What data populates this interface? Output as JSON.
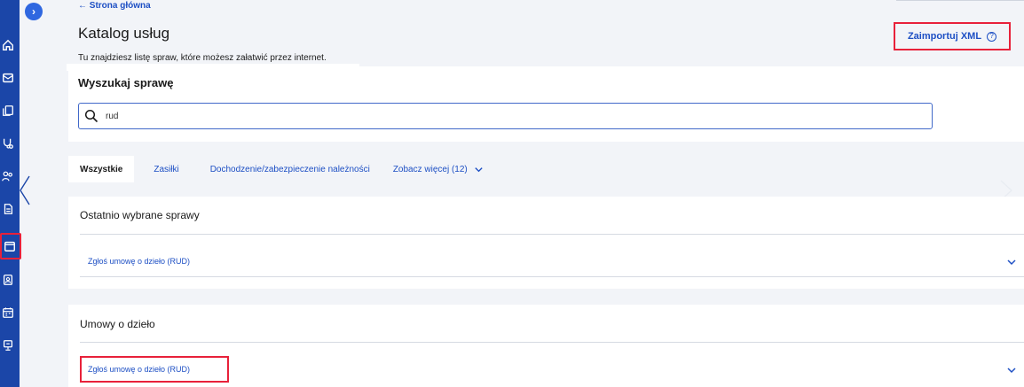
{
  "breadcrumb": {
    "back_label": "← Strona główna"
  },
  "header": {
    "title": "Katalog usług",
    "subtitle": "Tu znajdziesz listę spraw, które możesz załatwić przez internet.",
    "import_label": "Zaimportuj XML",
    "help_glyph": "?"
  },
  "search": {
    "label": "Wyszukaj sprawę",
    "value": "rud"
  },
  "tabs": [
    {
      "label": "Wszystkie"
    },
    {
      "label": "Zasiłki"
    },
    {
      "label": "Dochodzenie/zabezpieczenie należności"
    },
    {
      "label": "Zobacz więcej (12)"
    }
  ],
  "sections": [
    {
      "title": "Ostatnio wybrane sprawy",
      "items": [
        {
          "label": "Zgłoś umowę o dzieło (RUD)"
        }
      ]
    },
    {
      "title": "Umowy o dzieło",
      "items": [
        {
          "label": "Zgłoś umowę o dzieło (RUD)"
        }
      ]
    }
  ],
  "rail": {
    "toggle_glyph": "›",
    "icons": [
      "home-icon",
      "mail-icon",
      "documents-icon",
      "stethoscope-icon",
      "people-icon",
      "document-icon",
      "calendar-window-icon",
      "contact-card-icon",
      "calendar-icon",
      "presentation-icon"
    ]
  },
  "colors": {
    "brand_blue": "#1b46a8",
    "link_blue": "#1d4fc4",
    "highlight_red": "#e8213a",
    "page_bg": "#f2f4f8"
  }
}
